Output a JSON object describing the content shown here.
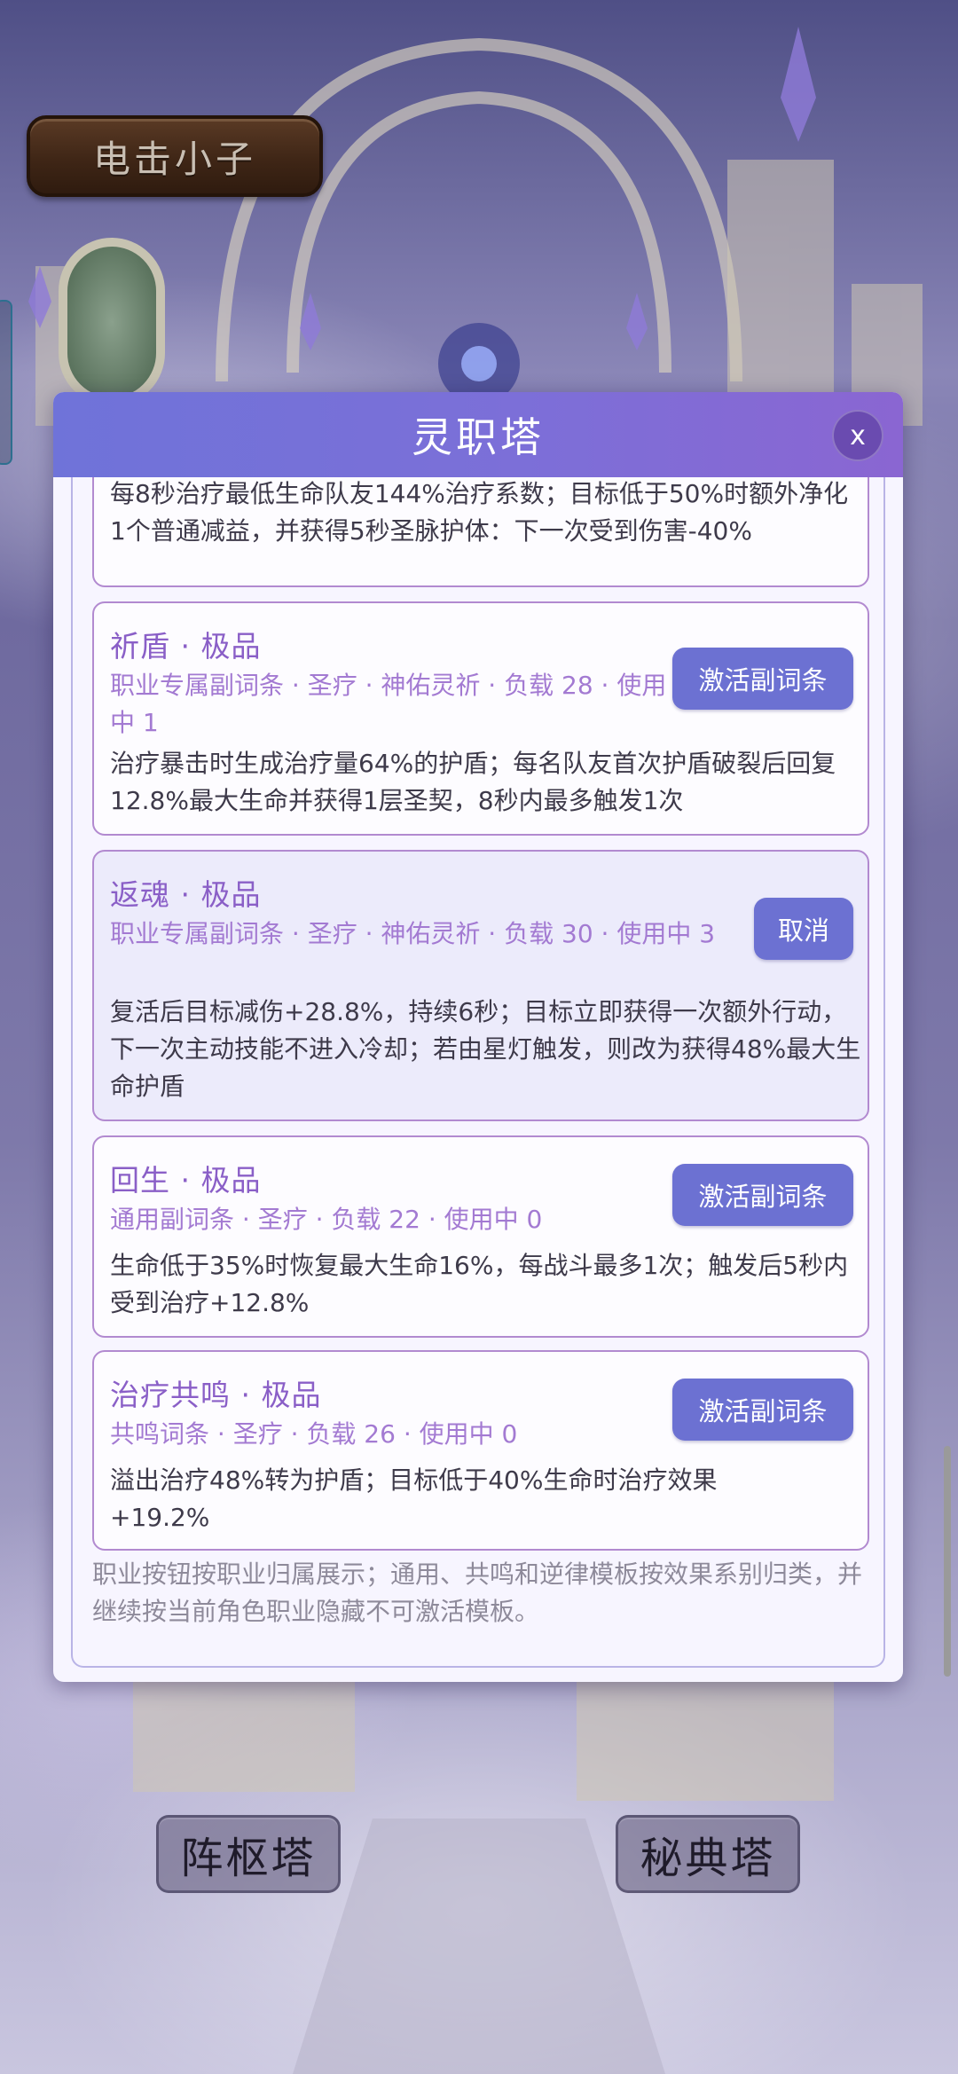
{
  "player": {
    "name": "电击小子"
  },
  "modal": {
    "title": "灵职塔",
    "close_label": "x",
    "partial_card": {
      "desc": "每8秒治疗最低生命队友144%治疗系数；目标低于50%时额外净化1个普通减益，并获得5秒圣脉护体：下一次受到伤害-40%"
    },
    "cards": [
      {
        "title": "祈盾 · 极品",
        "meta": "职业专属副词条 · 圣疗 · 神佑灵祈 · 负载 28 · 使用中 1",
        "desc": "治疗暴击时生成治疗量64%的护盾；每名队友首次护盾破裂后回复12.8%最大生命并获得1层圣契，8秒内最多触发1次",
        "button": "激活副词条",
        "active": false
      },
      {
        "title": "返魂 · 极品",
        "meta": "职业专属副词条 · 圣疗 · 神佑灵祈 · 负载 30 · 使用中 3",
        "desc": "复活后目标减伤+28.8%，持续6秒；目标立即获得一次额外行动，下一次主动技能不进入冷却；若由星灯触发，则改为获得48%最大生命护盾",
        "button": "取消",
        "active": true
      },
      {
        "title": "回生 · 极品",
        "meta": "通用副词条 · 圣疗 · 负载 22 · 使用中 0",
        "desc": "生命低于35%时恢复最大生命16%，每战斗最多1次；触发后5秒内受到治疗+12.8%",
        "button": "激活副词条",
        "active": false
      },
      {
        "title": "治疗共鸣 · 极品",
        "meta": "共鸣词条 · 圣疗 · 负载 26 · 使用中 0",
        "desc": "溢出治疗48%转为护盾；目标低于40%生命时治疗效果+19.2%",
        "button": "激活副词条",
        "active": false
      }
    ],
    "footnote": "职业按钮按职业归属展示；通用、共鸣和逆律模板按效果系别归类，并继续按当前角色职业隐藏不可激活模板。"
  },
  "bottom_nav": {
    "left_label": "阵枢塔",
    "right_label": "秘典塔"
  },
  "colors": {
    "header": "#7c6fd8",
    "button": "#6c71d2",
    "title_text": "#8a5fc7",
    "meta_text": "#a37ad2",
    "active_card": "#ecebfb"
  }
}
